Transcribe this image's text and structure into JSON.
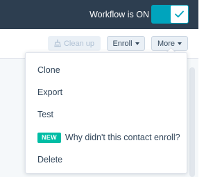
{
  "header": {
    "workflow_status": "Workflow is ON",
    "toggle_on": true
  },
  "toolbar": {
    "cleanup_label": "Clean up",
    "enroll_label": "Enroll",
    "more_label": "More"
  },
  "more_menu": {
    "items": [
      {
        "label": "Clone"
      },
      {
        "label": "Export"
      },
      {
        "label": "Test"
      },
      {
        "label": "Why didn't this contact enroll?",
        "badge": "NEW"
      },
      {
        "label": "Delete"
      }
    ]
  },
  "colors": {
    "topbar": "#2d3e50",
    "toggle_on": "#00a4bd",
    "new_badge": "#00bda5",
    "text": "#33475b"
  },
  "icons": {
    "toggle_check": "check-icon",
    "cleanup": "broom-icon",
    "dropdown": "caret-down-icon"
  }
}
